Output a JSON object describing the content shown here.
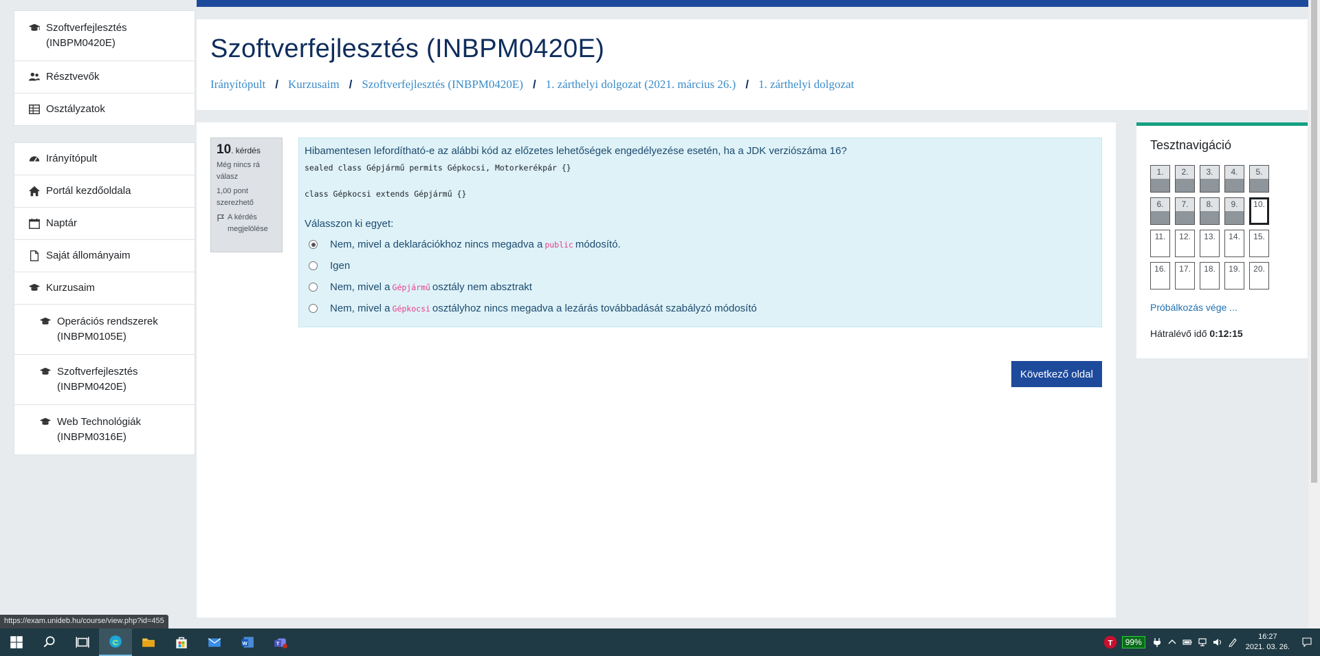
{
  "sidebar": {
    "course_block": [
      {
        "label": "Szoftverfejlesztés (INBPM0420E)",
        "icon": "graduation-cap-icon"
      },
      {
        "label": "Résztvevők",
        "icon": "users-icon"
      },
      {
        "label": "Osztályzatok",
        "icon": "table-icon"
      }
    ],
    "main_block": [
      {
        "label": "Irányítópult",
        "icon": "dashboard-icon"
      },
      {
        "label": "Portál kezdőoldala",
        "icon": "home-icon"
      },
      {
        "label": "Naptár",
        "icon": "calendar-icon"
      },
      {
        "label": "Saját állományaim",
        "icon": "file-icon"
      },
      {
        "label": "Kurzusaim",
        "icon": "graduation-cap-icon"
      }
    ],
    "courses": [
      {
        "label": "Operációs rendszerek (INBPM0105E)"
      },
      {
        "label": "Szoftverfejlesztés (INBPM0420E)"
      },
      {
        "label": "Web Technológiák (INBPM0316E)"
      }
    ]
  },
  "header": {
    "title": "Szoftverfejlesztés (INBPM0420E)",
    "breadcrumb": [
      "Irányítópult",
      "Kurzusaim",
      "Szoftverfejlesztés (INBPM0420E)",
      "1. zárthelyi dolgozat (2021. március 26.)",
      "1. zárthelyi dolgozat"
    ]
  },
  "question_info": {
    "number": "10",
    "number_suffix": ". kérdés",
    "state": "Még nincs rá válasz",
    "grade": "1,00 pont szerezhető",
    "flag_label": "A kérdés megjelölése"
  },
  "question": {
    "text": "Hibamentesen lefordítható-e az alábbi kód az előzetes lehetőségek engedélyezése esetén, ha a JDK verziószáma 16?",
    "code_line_1": "sealed class Gépjármű permits Gépkocsi, Motorkerékpár {}",
    "code_line_2": "class Gépkocsi extends Gépjármű {}",
    "prompt": "Válasszon ki egyet:",
    "answers": [
      {
        "before": "Nem, mivel a deklarációkhoz nincs megadva a",
        "code": "public",
        "after": "módosító.",
        "selected": true
      },
      {
        "before": "Igen",
        "code": "",
        "after": "",
        "selected": false
      },
      {
        "before": "Nem, mivel a",
        "code": "Gépjármű",
        "after": "osztály nem absztrakt",
        "selected": false
      },
      {
        "before": "Nem, mivel a",
        "code": "Gépkocsi",
        "after": "osztályhoz nincs megadva a lezárás továbbadását szabályzó módosító",
        "selected": false
      }
    ]
  },
  "next_button": "Következő oldal",
  "quiz_nav": {
    "title": "Tesztnavigáció",
    "buttons": [
      {
        "label": "1.",
        "answered": true
      },
      {
        "label": "2.",
        "answered": true
      },
      {
        "label": "3.",
        "answered": true
      },
      {
        "label": "4.",
        "answered": true
      },
      {
        "label": "5.",
        "answered": true
      },
      {
        "label": "6.",
        "answered": true
      },
      {
        "label": "7.",
        "answered": true
      },
      {
        "label": "8.",
        "answered": true
      },
      {
        "label": "9.",
        "answered": true
      },
      {
        "label": "10.",
        "answered": false,
        "current": true
      },
      {
        "label": "11.",
        "answered": false
      },
      {
        "label": "12.",
        "answered": false
      },
      {
        "label": "13.",
        "answered": false
      },
      {
        "label": "14.",
        "answered": false
      },
      {
        "label": "15.",
        "answered": false
      },
      {
        "label": "16.",
        "answered": false
      },
      {
        "label": "17.",
        "answered": false
      },
      {
        "label": "18.",
        "answered": false
      },
      {
        "label": "19.",
        "answered": false
      },
      {
        "label": "20.",
        "answered": false
      }
    ],
    "finish_link": "Próbálkozás vége ...",
    "timer_label": "Hátralévő idő",
    "timer_value": "0:12:15"
  },
  "status_url": "https://exam.unideb.hu/course/view.php?id=455",
  "taskbar": {
    "battery": "99%",
    "time": "16:27",
    "date": "2021. 03. 26."
  }
}
